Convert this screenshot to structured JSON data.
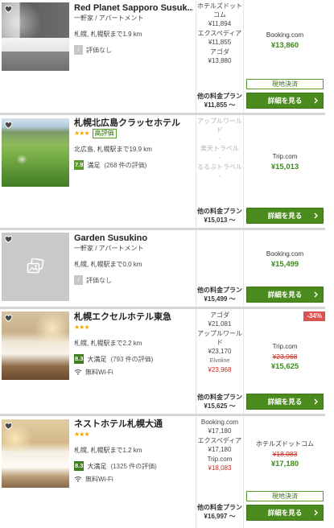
{
  "colors": {
    "price_green": "#3b8a1a",
    "button_green": "#4b8b1e",
    "strike_red": "#cc2a1e",
    "discount_red": "#d9534f",
    "score": "#5a9a2a",
    "score_dark": "#3f7f1f",
    "star": "#f0a800",
    "separator": "#d6d6d6"
  },
  "icons": {
    "favorite": "heart-icon",
    "wifi": "wifi-icon",
    "cta": "chevron-right-icon",
    "no_photo": "image-placeholder-icon"
  },
  "hotels": [
    {
      "name": "Red Planet Sapporo Susuk...",
      "type": "一軒家 / アパートメント",
      "location": "札幌, 札幌駅まで1.9 km",
      "rating": {
        "score": "/",
        "label": "評価なし"
      },
      "providers": [
        {
          "name": "ホテルズドットコム",
          "price": "¥11,894"
        },
        {
          "name": "エクスペディア",
          "price": "¥11,855"
        },
        {
          "name": "アゴダ",
          "price": "¥13,880"
        }
      ],
      "other_plans": {
        "label": "他の料金プラン",
        "price": "¥11,855",
        "suffix": "～"
      },
      "best": {
        "provider": "Booking.com",
        "price": "¥13,860",
        "payment": "現地決済"
      },
      "cta": "詳細を見る"
    },
    {
      "name": "札幌北広島クラッセホテル",
      "stars": "★★★",
      "badge": "高評価",
      "location": "北広島, 札幌駅まで19.9 km",
      "rating": {
        "score": "7.9",
        "label": "満足",
        "count": "(268 件の評価)"
      },
      "providers": [
        {
          "name": "アップルワールド",
          "price": "-"
        },
        {
          "name": "楽天トラベル",
          "price": "-"
        },
        {
          "name": "るるぶトラベル",
          "price": "-"
        }
      ],
      "other_plans": {
        "label": "他の料金プラン",
        "price": "¥15,013",
        "suffix": "～"
      },
      "best": {
        "provider": "Trip.com",
        "price": "¥15,013"
      },
      "cta": "詳細を見る"
    },
    {
      "name": "Garden Susukino",
      "type": "一軒家 / アパートメント",
      "location": "札幌, 札幌駅まで0.0 km",
      "rating": {
        "score": "/",
        "label": "評価なし"
      },
      "other_plans": {
        "label": "他の料金プラン",
        "price": "¥15,499",
        "suffix": "～"
      },
      "best": {
        "provider": "Booking.com",
        "price": "¥15,499"
      },
      "cta": "詳細を見る"
    },
    {
      "name": "札幌エクセルホテル東急",
      "stars": "★★★",
      "location": "札幌, 札幌駅まで2.2 km",
      "rating": {
        "score": "8.3",
        "label": "大満足",
        "count": "(793 件の評価)"
      },
      "amenity": "無料Wi-Fi",
      "providers": [
        {
          "name": "アゴダ",
          "price": "¥21,081"
        },
        {
          "name": "アップルワールド",
          "price": "¥23,170"
        },
        {
          "name": "Elvoline",
          "price": "¥23,968"
        }
      ],
      "other_plans": {
        "label": "他の料金プラン",
        "price": "¥15,625",
        "suffix": "～"
      },
      "best": {
        "discount": "-34%",
        "provider": "Trip.com",
        "old_price": "¥23,968",
        "price": "¥15,625"
      },
      "cta": "詳細を見る"
    },
    {
      "name": "ネストホテル札幌大通",
      "stars": "★★★",
      "location": "札幌, 札幌駅まで1.2 km",
      "rating": {
        "score": "8.3",
        "label": "大満足",
        "count": "(1325 件の評価)"
      },
      "amenity": "無料Wi-Fi",
      "providers": [
        {
          "name": "Booking.com",
          "price": "¥17,180"
        },
        {
          "name": "エクスペディア",
          "price": "¥17,180"
        },
        {
          "name": "Trip.com",
          "price": "¥18,083"
        }
      ],
      "other_plans": {
        "label": "他の料金プラン",
        "price": "¥16,997",
        "suffix": "～"
      },
      "best": {
        "provider": "ホテルズドットコム",
        "old_price": "¥18,083",
        "price": "¥17,180",
        "payment": "現地決済"
      },
      "cta": "詳細を見る"
    }
  ]
}
